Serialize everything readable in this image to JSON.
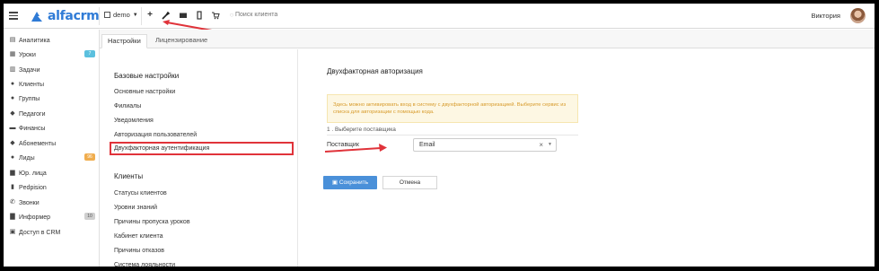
{
  "header": {
    "logo_text": "alfacrm",
    "branch": "demo",
    "search_placeholder": "Поиск клиента",
    "user_name": "Виктория"
  },
  "sidebar": {
    "items": [
      {
        "label": "Аналитика",
        "icon": "analytics-icon"
      },
      {
        "label": "Уроки",
        "icon": "calendar-icon",
        "badge": "7",
        "badge_color": "#5bc0de"
      },
      {
        "label": "Задачи",
        "icon": "tasks-icon"
      },
      {
        "label": "Клиенты",
        "icon": "user-icon"
      },
      {
        "label": "Группы",
        "icon": "group-icon"
      },
      {
        "label": "Педагоги",
        "icon": "teacher-icon"
      },
      {
        "label": "Финансы",
        "icon": "money-icon"
      },
      {
        "label": "Абонементы",
        "icon": "subscription-icon"
      },
      {
        "label": "Лиды",
        "icon": "leads-icon",
        "badge": "96",
        "badge_color": "#f0ad4e"
      },
      {
        "label": "Юр. лица",
        "icon": "briefcase-icon"
      },
      {
        "label": "Pedpision",
        "icon": "document-icon"
      },
      {
        "label": "Звонки",
        "icon": "phone-icon"
      },
      {
        "label": "Информер",
        "icon": "informer-icon",
        "badge": "10",
        "badge_color": "#cfcfcf"
      },
      {
        "label": "Доступ в CRM",
        "icon": "lock-icon"
      }
    ]
  },
  "tabs": [
    {
      "label": "Настройки",
      "active": true
    },
    {
      "label": "Лицензирование",
      "active": false
    }
  ],
  "menu": {
    "section1": "Базовые настройки",
    "items1": [
      "Основные настройки",
      "Филиалы",
      "Уведомления",
      "Авторизация пользователей",
      "Двухфакторная аутентификация"
    ],
    "section2": "Клиенты",
    "items2": [
      "Статусы клиентов",
      "Уровни знаний",
      "Причины пропуска уроков",
      "Кабинет клиента",
      "Причины отказов",
      "Система лояльности"
    ]
  },
  "content": {
    "title": "Двухфакторная авторизация",
    "alert_text": "Здесь можно активировать вход в систему с двухфакторной авторизацией. Выберите сервис из списка для авторизации с помощью кода.",
    "step": "1 . Выберите поставщика",
    "provider_label": "Поставщик",
    "provider_value": "Email",
    "save_label": "Сохранить",
    "cancel_label": "Отмена"
  },
  "colors": {
    "brand": "#2f7bd6",
    "annotation_red": "#e0333a",
    "save_button": "#4a90d9"
  }
}
